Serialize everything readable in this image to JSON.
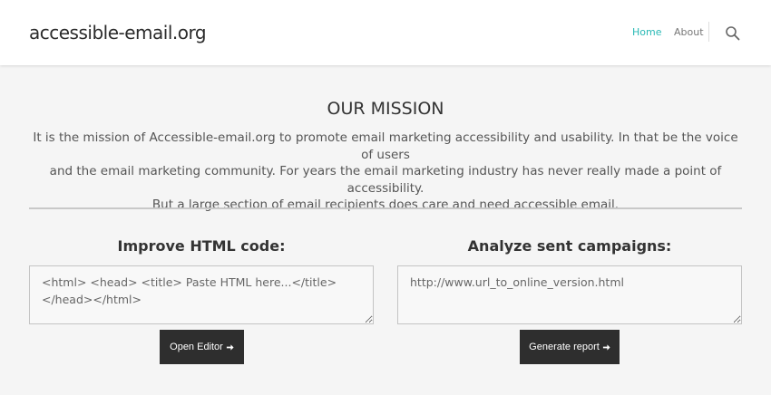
{
  "header": {
    "logo": "accessible-email.org",
    "nav": {
      "home": "Home",
      "about": "About"
    },
    "search_icon": "search-icon"
  },
  "mission": {
    "title": "OUR MISSION",
    "line1": "It is the mission of Accessible-email.org to promote email marketing accessibility and usability. In that be the voice of users",
    "line2": "and the email marketing community. For years the email marketing industry has never really made a point of accessibility.",
    "line3": "But a large section of email recipients does care and need accessible email."
  },
  "improve": {
    "title": "Improve HTML code:",
    "placeholder": "<html> <head> <title> Paste HTML here...</title> </head></html>",
    "button": "Open Editor"
  },
  "analyze": {
    "title": "Analyze sent campaigns:",
    "placeholder": "http://www.url_to_online_version.html",
    "button": "Generate report"
  },
  "colors": {
    "accent": "#28b9b5",
    "button_bg": "#2e2e2e",
    "page_bg": "#f5f5f5"
  }
}
